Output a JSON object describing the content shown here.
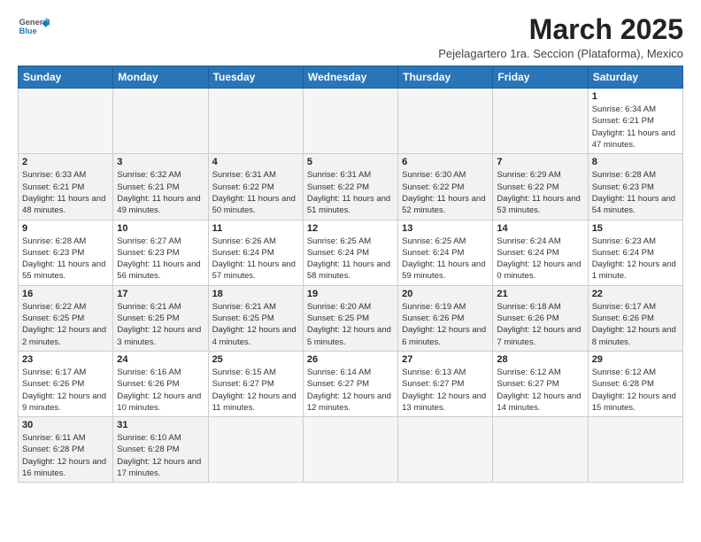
{
  "logo": {
    "text_general": "General",
    "text_blue": "Blue"
  },
  "header": {
    "month_title": "March 2025",
    "subtitle": "Pejelagartero 1ra. Seccion (Plataforma), Mexico"
  },
  "calendar": {
    "days_of_week": [
      "Sunday",
      "Monday",
      "Tuesday",
      "Wednesday",
      "Thursday",
      "Friday",
      "Saturday"
    ],
    "weeks": [
      [
        {
          "day": "",
          "sunrise": "",
          "sunset": "",
          "daylight": "",
          "empty": true
        },
        {
          "day": "",
          "sunrise": "",
          "sunset": "",
          "daylight": "",
          "empty": true
        },
        {
          "day": "",
          "sunrise": "",
          "sunset": "",
          "daylight": "",
          "empty": true
        },
        {
          "day": "",
          "sunrise": "",
          "sunset": "",
          "daylight": "",
          "empty": true
        },
        {
          "day": "",
          "sunrise": "",
          "sunset": "",
          "daylight": "",
          "empty": true
        },
        {
          "day": "",
          "sunrise": "",
          "sunset": "",
          "daylight": "",
          "empty": true
        },
        {
          "day": "1",
          "sunrise": "Sunrise: 6:34 AM",
          "sunset": "Sunset: 6:21 PM",
          "daylight": "Daylight: 11 hours and 47 minutes.",
          "empty": false
        }
      ],
      [
        {
          "day": "2",
          "sunrise": "Sunrise: 6:33 AM",
          "sunset": "Sunset: 6:21 PM",
          "daylight": "Daylight: 11 hours and 48 minutes.",
          "empty": false
        },
        {
          "day": "3",
          "sunrise": "Sunrise: 6:32 AM",
          "sunset": "Sunset: 6:21 PM",
          "daylight": "Daylight: 11 hours and 49 minutes.",
          "empty": false
        },
        {
          "day": "4",
          "sunrise": "Sunrise: 6:31 AM",
          "sunset": "Sunset: 6:22 PM",
          "daylight": "Daylight: 11 hours and 50 minutes.",
          "empty": false
        },
        {
          "day": "5",
          "sunrise": "Sunrise: 6:31 AM",
          "sunset": "Sunset: 6:22 PM",
          "daylight": "Daylight: 11 hours and 51 minutes.",
          "empty": false
        },
        {
          "day": "6",
          "sunrise": "Sunrise: 6:30 AM",
          "sunset": "Sunset: 6:22 PM",
          "daylight": "Daylight: 11 hours and 52 minutes.",
          "empty": false
        },
        {
          "day": "7",
          "sunrise": "Sunrise: 6:29 AM",
          "sunset": "Sunset: 6:22 PM",
          "daylight": "Daylight: 11 hours and 53 minutes.",
          "empty": false
        },
        {
          "day": "8",
          "sunrise": "Sunrise: 6:28 AM",
          "sunset": "Sunset: 6:23 PM",
          "daylight": "Daylight: 11 hours and 54 minutes.",
          "empty": false
        }
      ],
      [
        {
          "day": "9",
          "sunrise": "Sunrise: 6:28 AM",
          "sunset": "Sunset: 6:23 PM",
          "daylight": "Daylight: 11 hours and 55 minutes.",
          "empty": false
        },
        {
          "day": "10",
          "sunrise": "Sunrise: 6:27 AM",
          "sunset": "Sunset: 6:23 PM",
          "daylight": "Daylight: 11 hours and 56 minutes.",
          "empty": false
        },
        {
          "day": "11",
          "sunrise": "Sunrise: 6:26 AM",
          "sunset": "Sunset: 6:24 PM",
          "daylight": "Daylight: 11 hours and 57 minutes.",
          "empty": false
        },
        {
          "day": "12",
          "sunrise": "Sunrise: 6:25 AM",
          "sunset": "Sunset: 6:24 PM",
          "daylight": "Daylight: 11 hours and 58 minutes.",
          "empty": false
        },
        {
          "day": "13",
          "sunrise": "Sunrise: 6:25 AM",
          "sunset": "Sunset: 6:24 PM",
          "daylight": "Daylight: 11 hours and 59 minutes.",
          "empty": false
        },
        {
          "day": "14",
          "sunrise": "Sunrise: 6:24 AM",
          "sunset": "Sunset: 6:24 PM",
          "daylight": "Daylight: 12 hours and 0 minutes.",
          "empty": false
        },
        {
          "day": "15",
          "sunrise": "Sunrise: 6:23 AM",
          "sunset": "Sunset: 6:24 PM",
          "daylight": "Daylight: 12 hours and 1 minute.",
          "empty": false
        }
      ],
      [
        {
          "day": "16",
          "sunrise": "Sunrise: 6:22 AM",
          "sunset": "Sunset: 6:25 PM",
          "daylight": "Daylight: 12 hours and 2 minutes.",
          "empty": false
        },
        {
          "day": "17",
          "sunrise": "Sunrise: 6:21 AM",
          "sunset": "Sunset: 6:25 PM",
          "daylight": "Daylight: 12 hours and 3 minutes.",
          "empty": false
        },
        {
          "day": "18",
          "sunrise": "Sunrise: 6:21 AM",
          "sunset": "Sunset: 6:25 PM",
          "daylight": "Daylight: 12 hours and 4 minutes.",
          "empty": false
        },
        {
          "day": "19",
          "sunrise": "Sunrise: 6:20 AM",
          "sunset": "Sunset: 6:25 PM",
          "daylight": "Daylight: 12 hours and 5 minutes.",
          "empty": false
        },
        {
          "day": "20",
          "sunrise": "Sunrise: 6:19 AM",
          "sunset": "Sunset: 6:26 PM",
          "daylight": "Daylight: 12 hours and 6 minutes.",
          "empty": false
        },
        {
          "day": "21",
          "sunrise": "Sunrise: 6:18 AM",
          "sunset": "Sunset: 6:26 PM",
          "daylight": "Daylight: 12 hours and 7 minutes.",
          "empty": false
        },
        {
          "day": "22",
          "sunrise": "Sunrise: 6:17 AM",
          "sunset": "Sunset: 6:26 PM",
          "daylight": "Daylight: 12 hours and 8 minutes.",
          "empty": false
        }
      ],
      [
        {
          "day": "23",
          "sunrise": "Sunrise: 6:17 AM",
          "sunset": "Sunset: 6:26 PM",
          "daylight": "Daylight: 12 hours and 9 minutes.",
          "empty": false
        },
        {
          "day": "24",
          "sunrise": "Sunrise: 6:16 AM",
          "sunset": "Sunset: 6:26 PM",
          "daylight": "Daylight: 12 hours and 10 minutes.",
          "empty": false
        },
        {
          "day": "25",
          "sunrise": "Sunrise: 6:15 AM",
          "sunset": "Sunset: 6:27 PM",
          "daylight": "Daylight: 12 hours and 11 minutes.",
          "empty": false
        },
        {
          "day": "26",
          "sunrise": "Sunrise: 6:14 AM",
          "sunset": "Sunset: 6:27 PM",
          "daylight": "Daylight: 12 hours and 12 minutes.",
          "empty": false
        },
        {
          "day": "27",
          "sunrise": "Sunrise: 6:13 AM",
          "sunset": "Sunset: 6:27 PM",
          "daylight": "Daylight: 12 hours and 13 minutes.",
          "empty": false
        },
        {
          "day": "28",
          "sunrise": "Sunrise: 6:12 AM",
          "sunset": "Sunset: 6:27 PM",
          "daylight": "Daylight: 12 hours and 14 minutes.",
          "empty": false
        },
        {
          "day": "29",
          "sunrise": "Sunrise: 6:12 AM",
          "sunset": "Sunset: 6:28 PM",
          "daylight": "Daylight: 12 hours and 15 minutes.",
          "empty": false
        }
      ],
      [
        {
          "day": "30",
          "sunrise": "Sunrise: 6:11 AM",
          "sunset": "Sunset: 6:28 PM",
          "daylight": "Daylight: 12 hours and 16 minutes.",
          "empty": false
        },
        {
          "day": "31",
          "sunrise": "Sunrise: 6:10 AM",
          "sunset": "Sunset: 6:28 PM",
          "daylight": "Daylight: 12 hours and 17 minutes.",
          "empty": false
        },
        {
          "day": "",
          "sunrise": "",
          "sunset": "",
          "daylight": "",
          "empty": true
        },
        {
          "day": "",
          "sunrise": "",
          "sunset": "",
          "daylight": "",
          "empty": true
        },
        {
          "day": "",
          "sunrise": "",
          "sunset": "",
          "daylight": "",
          "empty": true
        },
        {
          "day": "",
          "sunrise": "",
          "sunset": "",
          "daylight": "",
          "empty": true
        },
        {
          "day": "",
          "sunrise": "",
          "sunset": "",
          "daylight": "",
          "empty": true
        }
      ]
    ]
  }
}
